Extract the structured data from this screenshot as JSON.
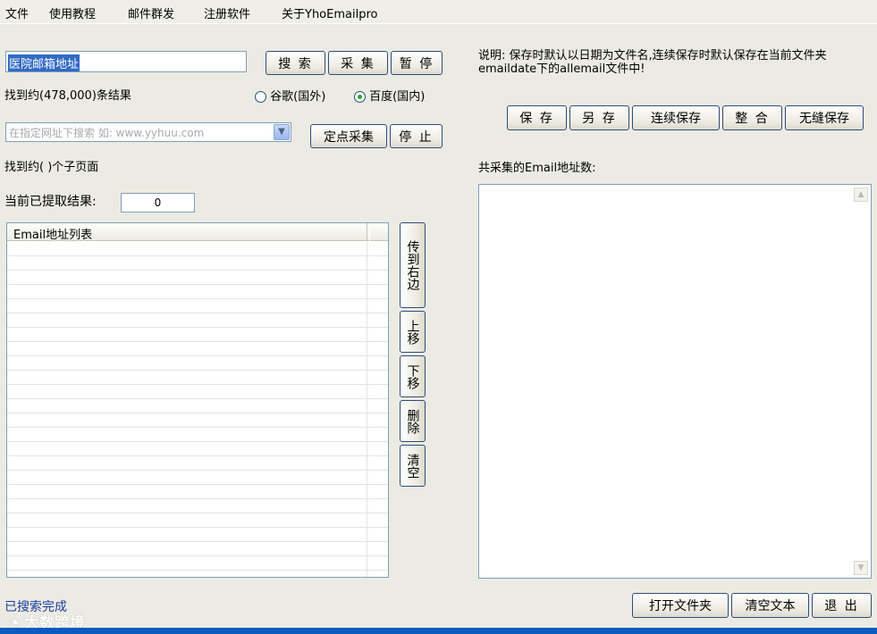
{
  "menu": [
    "文件",
    "使用教程",
    "邮件群发",
    "注册软件",
    "关于YhoEmailpro"
  ],
  "search": {
    "keyword": "医院邮箱地址",
    "search_btn": "搜 索",
    "collect_btn": "采 集",
    "pause_btn": "暂 停",
    "result_count": "找到约(478,000)条结果",
    "engine_google": "谷歌(国外)",
    "engine_baidu": "百度(国内)",
    "selected_engine": "baidu",
    "site_placeholder": "在指定网址下搜索 如: www.yyhuu.com",
    "fixed_collect_btn": "定点采集",
    "stop_btn": "停 止",
    "subpage_count": "找到约( )个子页面",
    "extracted_label": "当前已提取结果:",
    "extracted_value": "0"
  },
  "email_list": {
    "column_header": "Email地址列表",
    "rows": []
  },
  "side_buttons": {
    "to_right": "传到右边",
    "move_up": "上移",
    "move_down": "下移",
    "delete": "删除",
    "clear": "清空"
  },
  "right_panel": {
    "note": "说明: 保存时默认以日期为文件名,连续保存时默认保存在当前文件夹emaildate下的allemail文件中!",
    "save_btn": "保 存",
    "save_as_btn": "另 存",
    "continuous_save_btn": "连续保存",
    "merge_btn": "整 合",
    "seamless_save_btn": "无缝保存",
    "total_label": "共采集的Email地址数:",
    "text_content": ""
  },
  "footer": {
    "status": "已搜索完成",
    "open_folder_btn": "打开文件夹",
    "clear_text_btn": "清空文本",
    "exit_btn": "退 出",
    "watermark": "大数跨境"
  },
  "colors": {
    "accent_blue": "#0a5bbf",
    "status_text": "#1a3fa0",
    "selection": "#316ac5"
  }
}
